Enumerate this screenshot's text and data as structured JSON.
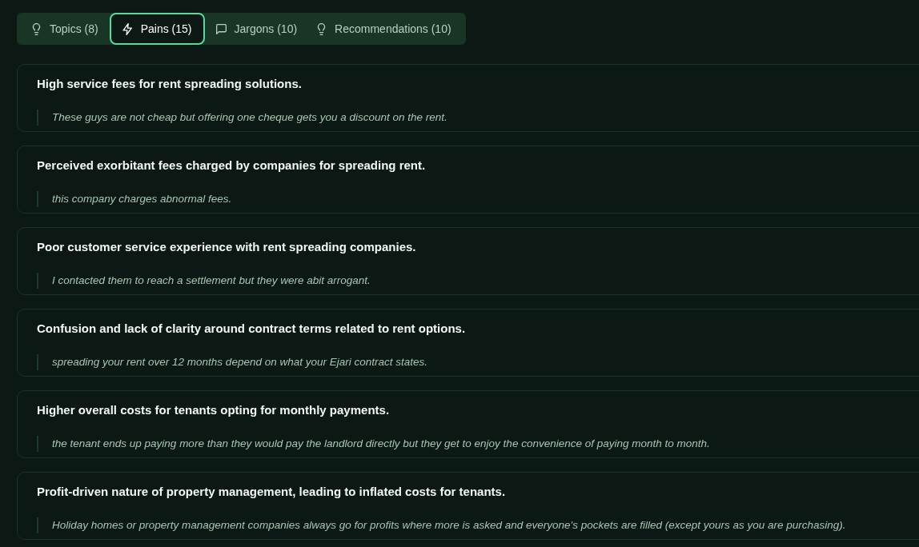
{
  "tabs": [
    {
      "label": "Topics (8)",
      "kind": "topics",
      "selected": false
    },
    {
      "label": "Pains (15)",
      "kind": "pains",
      "selected": true
    },
    {
      "label": "Jargons (10)",
      "kind": "jargons",
      "selected": false
    },
    {
      "label": "Recommendations (10)",
      "kind": "recommendations",
      "selected": false
    }
  ],
  "pains": [
    {
      "title": "High service fees for rent spreading solutions.",
      "quote": "These guys are not cheap but offering one cheque gets you a discount on the rent."
    },
    {
      "title": "Perceived exorbitant fees charged by companies for spreading rent.",
      "quote": "this company charges abnormal fees."
    },
    {
      "title": "Poor customer service experience with rent spreading companies.",
      "quote": "I contacted them to reach a settlement but they were abit arrogant."
    },
    {
      "title": "Confusion and lack of clarity around contract terms related to rent options.",
      "quote": "spreading your rent over 12 months depend on what your Ejari contract states."
    },
    {
      "title": "Higher overall costs for tenants opting for monthly payments.",
      "quote": "the tenant ends up paying more than they would pay the landlord directly but they get to enjoy the convenience of paying month to month."
    },
    {
      "title": "Profit-driven nature of property management, leading to inflated costs for tenants.",
      "quote": "Holiday homes or property management companies always go for profits where more is asked and everyone's pockets are filled (except yours as you are purchasing)."
    }
  ]
}
